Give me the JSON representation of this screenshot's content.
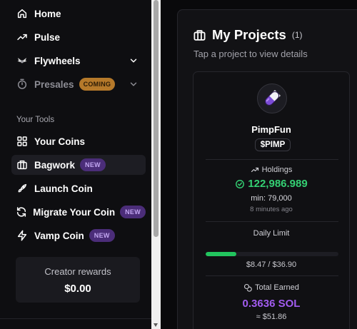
{
  "sidebar": {
    "nav": [
      {
        "label": "Home"
      },
      {
        "label": "Pulse"
      },
      {
        "label": "Flywheels"
      },
      {
        "label": "Presales",
        "badge": "COMING"
      }
    ],
    "tools_title": "Your Tools",
    "tools": [
      {
        "label": "Your Coins"
      },
      {
        "label": "Bagwork",
        "badge": "NEW"
      },
      {
        "label": "Launch Coin"
      },
      {
        "label": "Migrate Your Coin",
        "badge": "NEW"
      },
      {
        "label": "Vamp Coin",
        "badge": "NEW"
      }
    ],
    "creator": {
      "title": "Creator rewards",
      "amount": "$0.00"
    }
  },
  "main": {
    "title": "My Projects",
    "count": "(1)",
    "subtitle": "Tap a project to view details",
    "project": {
      "name": "PimpFun",
      "ticker": "$PIMP",
      "holdings_label": "Holdings",
      "holdings_value": "122,986.989",
      "min_text": "min: 79,000",
      "time_text": "8 minutes ago",
      "daily_limit_label": "Daily Limit",
      "daily_limit_progress": 0.23,
      "daily_limit_text": "$8.47 / $36.90",
      "earned_label": "Total Earned",
      "earned_sol": "0.3636 SOL",
      "earned_usd": "≈ $51.86"
    }
  },
  "colors": {
    "accent_green": "#22c55e",
    "accent_purple": "#a25cf0",
    "badge_coming": "#b5792a",
    "badge_new": "#4b2d79"
  },
  "icons": [
    "home-icon",
    "pulse-icon",
    "flywheel-icon",
    "timer-icon",
    "grid-icon",
    "briefcase-icon",
    "rocket-icon",
    "refresh-icon",
    "bolt-icon",
    "pill-icon",
    "trending-icon",
    "check-circle-icon",
    "coins-icon"
  ]
}
